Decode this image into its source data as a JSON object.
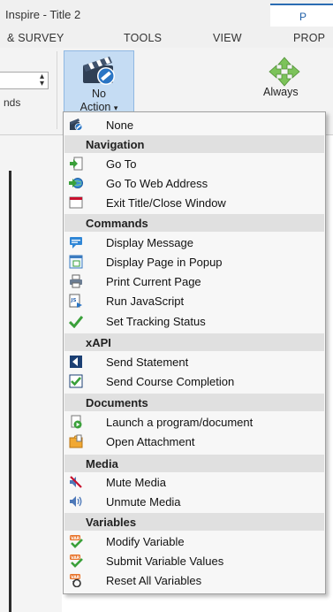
{
  "window": {
    "title": "Inspire - Title 2"
  },
  "context_tab": {
    "label": "P"
  },
  "tabs": [
    {
      "label": "& SURVEY"
    },
    {
      "label": "TOOLS"
    },
    {
      "label": "VIEW"
    },
    {
      "label": "PROP"
    }
  ],
  "ribbon": {
    "left_label_fragment": "nds",
    "action_button": {
      "line1": "No",
      "line2": "Action",
      "caret": "▾"
    },
    "always_button": {
      "label": "Always"
    }
  },
  "menu": {
    "items": [
      {
        "type": "item",
        "label": "None",
        "icon": "no-action-icon"
      },
      {
        "type": "header",
        "label": "Navigation"
      },
      {
        "type": "item",
        "label": "Go To",
        "icon": "goto-icon"
      },
      {
        "type": "item",
        "label": "Go To Web Address",
        "icon": "web-address-icon"
      },
      {
        "type": "item",
        "label": "Exit Title/Close Window",
        "icon": "exit-window-icon"
      },
      {
        "type": "header",
        "label": "Commands"
      },
      {
        "type": "item",
        "label": "Display Message",
        "icon": "message-icon"
      },
      {
        "type": "item",
        "label": "Display Page in Popup",
        "icon": "popup-icon"
      },
      {
        "type": "item",
        "label": "Print Current Page",
        "icon": "printer-icon"
      },
      {
        "type": "item",
        "label": "Run JavaScript",
        "icon": "javascript-icon"
      },
      {
        "type": "item",
        "label": "Set Tracking Status",
        "icon": "checkmark-icon"
      },
      {
        "type": "header",
        "label": "xAPI"
      },
      {
        "type": "item",
        "label": "Send Statement",
        "icon": "xapi-statement-icon"
      },
      {
        "type": "item",
        "label": "Send Course Completion",
        "icon": "course-completion-icon"
      },
      {
        "type": "header",
        "label": "Documents"
      },
      {
        "type": "item",
        "label": "Launch a program/document",
        "icon": "launch-document-icon"
      },
      {
        "type": "item",
        "label": "Open Attachment",
        "icon": "attachment-icon"
      },
      {
        "type": "header",
        "label": "Media"
      },
      {
        "type": "item",
        "label": "Mute Media",
        "icon": "mute-icon"
      },
      {
        "type": "item",
        "label": "Unmute Media",
        "icon": "unmute-icon"
      },
      {
        "type": "header",
        "label": "Variables"
      },
      {
        "type": "item",
        "label": "Modify Variable",
        "icon": "modify-variable-icon"
      },
      {
        "type": "item",
        "label": "Submit Variable Values",
        "icon": "submit-variable-icon"
      },
      {
        "type": "item",
        "label": "Reset All Variables",
        "icon": "reset-variables-icon"
      }
    ]
  },
  "colors": {
    "accent": "#2b6cb3",
    "selected_button": "#c5dcf3",
    "menu_header": "#e0e0e0"
  }
}
